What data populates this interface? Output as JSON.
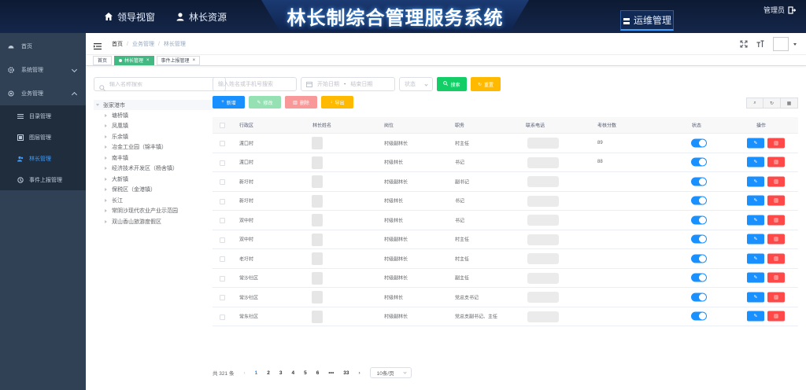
{
  "header": {
    "title": "林长制综合管理服务系统",
    "nav": [
      {
        "label": "领导视窗",
        "icon": "home-icon"
      },
      {
        "label": "林长资源",
        "icon": "user-icon"
      }
    ],
    "ops_label": "运维管理",
    "admin_label": "管理员"
  },
  "sidebar": {
    "items": [
      {
        "label": "首页",
        "icon": "dashboard-icon"
      },
      {
        "label": "系统管理",
        "icon": "gear-icon"
      },
      {
        "label": "业务管理",
        "icon": "settings-icon"
      }
    ],
    "sub_items": [
      {
        "label": "目录管理",
        "icon": "list-icon"
      },
      {
        "label": "图层管理",
        "icon": "layers-icon"
      },
      {
        "label": "林长管理",
        "icon": "users-icon",
        "active": true
      },
      {
        "label": "事件上报管理",
        "icon": "report-icon"
      }
    ]
  },
  "breadcrumb": [
    "首页",
    "业务管理",
    "林长管理"
  ],
  "tags": [
    {
      "label": "首页",
      "active": false,
      "closable": false
    },
    {
      "label": "林长管理",
      "active": true,
      "closable": true
    },
    {
      "label": "事件上报管理",
      "active": false,
      "closable": true
    }
  ],
  "tree": {
    "search_placeholder": "输入名称搜索",
    "root": "张家港市",
    "children": [
      "塘桥镇",
      "凤凰镇",
      "乐余镇",
      "冶金工业园（锦丰镇）",
      "南丰镇",
      "经济技术开发区（杨舍镇）",
      "大新镇",
      "保税区（金港镇）",
      "长江",
      "常阴沙现代农业产业示范园",
      "双山香山旅游度假区"
    ]
  },
  "filters": {
    "keyword_placeholder": "输入姓名或手机号搜索",
    "start_placeholder": "开始日期",
    "range_sep": "-",
    "end_placeholder": "结束日期",
    "status_placeholder": "状态",
    "search_label": "搜索",
    "reset_label": "重置"
  },
  "actions": {
    "add": "新增",
    "edit": "修改",
    "delete": "删除",
    "export": "导出"
  },
  "table": {
    "columns": [
      "行政区",
      "林长姓名",
      "岗位",
      "职务",
      "联系电话",
      "考核分数",
      "状态",
      "操作"
    ],
    "rows": [
      {
        "area": "渡口村",
        "post": "村级副林长",
        "duty": "村主任",
        "score": "89",
        "status": true
      },
      {
        "area": "渡口村",
        "post": "村级林长",
        "duty": "书记",
        "score": "88",
        "status": true
      },
      {
        "area": "新圩村",
        "post": "村级副林长",
        "duty": "副书记",
        "score": "",
        "status": true
      },
      {
        "area": "新圩村",
        "post": "村级林长",
        "duty": "书记",
        "score": "",
        "status": true
      },
      {
        "area": "双中村",
        "post": "村级林长",
        "duty": "书记",
        "score": "",
        "status": true
      },
      {
        "area": "双中村",
        "post": "村级副林长",
        "duty": "村主任",
        "score": "",
        "status": true
      },
      {
        "area": "老圩村",
        "post": "村级副林长",
        "duty": "村主任",
        "score": "",
        "status": true
      },
      {
        "area": "常沙社区",
        "post": "村级副林长",
        "duty": "副主任",
        "score": "",
        "status": true
      },
      {
        "area": "常沙社区",
        "post": "村级林长",
        "duty": "党总支书记",
        "score": "",
        "status": true
      },
      {
        "area": "常东社区",
        "post": "村级副林长",
        "duty": "党总支副书记、主任",
        "score": "",
        "status": true
      }
    ]
  },
  "pagination": {
    "total_label": "共 321 条",
    "pages": [
      "1",
      "2",
      "3",
      "4",
      "5",
      "6",
      "•••",
      "33"
    ],
    "current": "1",
    "page_size_label": "10条/页"
  }
}
